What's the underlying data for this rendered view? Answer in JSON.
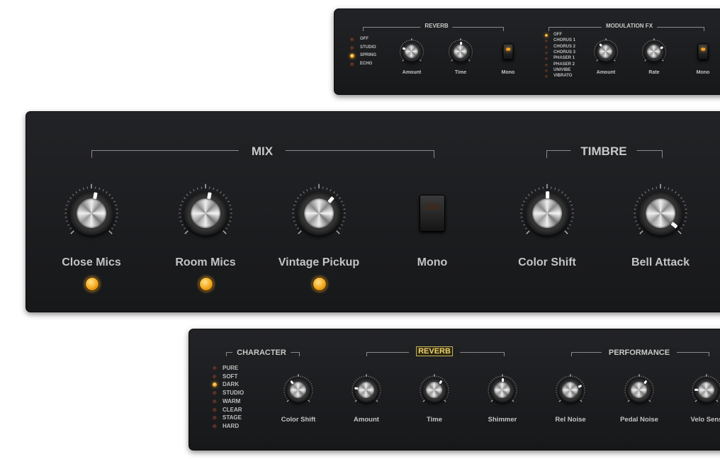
{
  "top_panel": {
    "reverb": {
      "title": "REVERB",
      "options": [
        {
          "label": "OFF",
          "on": false
        },
        {
          "label": "STUDIO",
          "on": false
        },
        {
          "label": "SPRING",
          "on": true
        },
        {
          "label": "ECHO",
          "on": false
        }
      ],
      "knobs": [
        {
          "label": "Amount",
          "value": 0.24
        },
        {
          "label": "Time",
          "value": 0.5
        }
      ],
      "mono": {
        "label": "Mono",
        "on": true
      }
    },
    "modulation": {
      "title": "MODULATION FX",
      "options": [
        {
          "label": "OFF",
          "on": true
        },
        {
          "label": "CHORUS 1",
          "on": false
        },
        {
          "label": "CHORUS 2",
          "on": false
        },
        {
          "label": "CHORUS 3",
          "on": false
        },
        {
          "label": "PHASER 1",
          "on": false
        },
        {
          "label": "PHASER 2",
          "on": false
        },
        {
          "label": "UNIVIBE",
          "on": false
        },
        {
          "label": "VIBRATO",
          "on": false
        }
      ],
      "knobs": [
        {
          "label": "Amount",
          "value": 0.35
        },
        {
          "label": "Rate",
          "value": 0.72
        }
      ],
      "mono": {
        "label": "Mono",
        "on": true
      }
    }
  },
  "main_panel": {
    "mix_title": "MIX",
    "timbre_title": "TIMBRE",
    "knobs": [
      {
        "label": "Close Mics",
        "value": 0.54,
        "led": true
      },
      {
        "label": "Room Mics",
        "value": 0.54,
        "led": true
      },
      {
        "label": "Vintage Pickup",
        "value": 0.65,
        "led": true
      },
      {
        "label": "Color Shift",
        "value": 0.5
      },
      {
        "label": "Bell Attack",
        "value": 0.98
      }
    ],
    "mono": {
      "label": "Mono",
      "on": false
    }
  },
  "bottom_panel": {
    "character_title": "CHARACTER",
    "reverb_title": "REVERB",
    "performance_title": "PERFORMANCE",
    "options": [
      {
        "label": "PURE",
        "on": false
      },
      {
        "label": "SOFT",
        "on": false
      },
      {
        "label": "DARK",
        "on": true
      },
      {
        "label": "STUDIO",
        "on": false
      },
      {
        "label": "WARM",
        "on": false
      },
      {
        "label": "CLEAR",
        "on": false
      },
      {
        "label": "STAGE",
        "on": false
      },
      {
        "label": "HARD",
        "on": false
      }
    ],
    "knobs": [
      {
        "label": "Color Shift",
        "value": 0.35
      },
      {
        "label": "Amount",
        "value": 0.2
      },
      {
        "label": "Time",
        "value": 0.63
      },
      {
        "label": "Shimmer",
        "value": 0.5
      },
      {
        "label": "Rel Noise",
        "value": 0.74
      },
      {
        "label": "Pedal Noise",
        "value": 0.63
      },
      {
        "label": "Velo Sens",
        "value": 0.17
      }
    ]
  },
  "colors": {
    "led_on": "#f5a623",
    "panel": "#1d1e20",
    "highlight": "#f1d46a"
  }
}
